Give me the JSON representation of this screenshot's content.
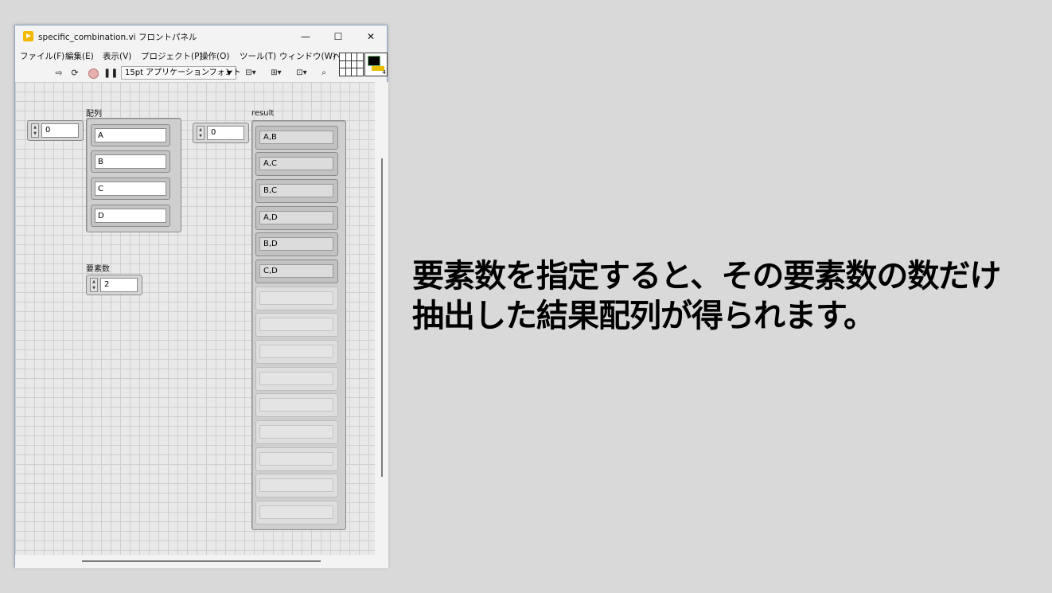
{
  "window": {
    "title": "specific_combination.vi フロントパネル",
    "controls": {
      "minimize": "—",
      "maximize": "☐",
      "close": "✕"
    }
  },
  "menu": [
    "ファイル(F)",
    "編集(E)",
    "表示(V)",
    "プロジェクト(P)",
    "操作(O)",
    "ツール(T)",
    "ウィンドウ(W)",
    "ヘ"
  ],
  "toolbar": {
    "font_select": "15pt アプリケーションフォント",
    "icons": [
      "run-arrow-icon",
      "run-continuously-icon",
      "abort-icon",
      "pause-icon",
      "align-icon",
      "distribute-icon",
      "resize-icon",
      "search-icon"
    ]
  },
  "connector": {
    "terminal_number": "4"
  },
  "panel": {
    "input_array": {
      "label": "配列",
      "index": "0",
      "elements": [
        "A",
        "B",
        "C",
        "D"
      ]
    },
    "element_count": {
      "label": "要素数",
      "value": "2"
    },
    "result_array": {
      "label": "result",
      "index": "0",
      "elements": [
        "A,B",
        "A,C",
        "B,C",
        "A,D",
        "B,D",
        "C,D",
        "",
        "",
        "",
        "",
        "",
        "",
        "",
        "",
        ""
      ]
    }
  },
  "caption": {
    "line1": "要素数を指定すると、その要素数の数だけ",
    "line2": "抽出した結果配列が得られます。"
  }
}
